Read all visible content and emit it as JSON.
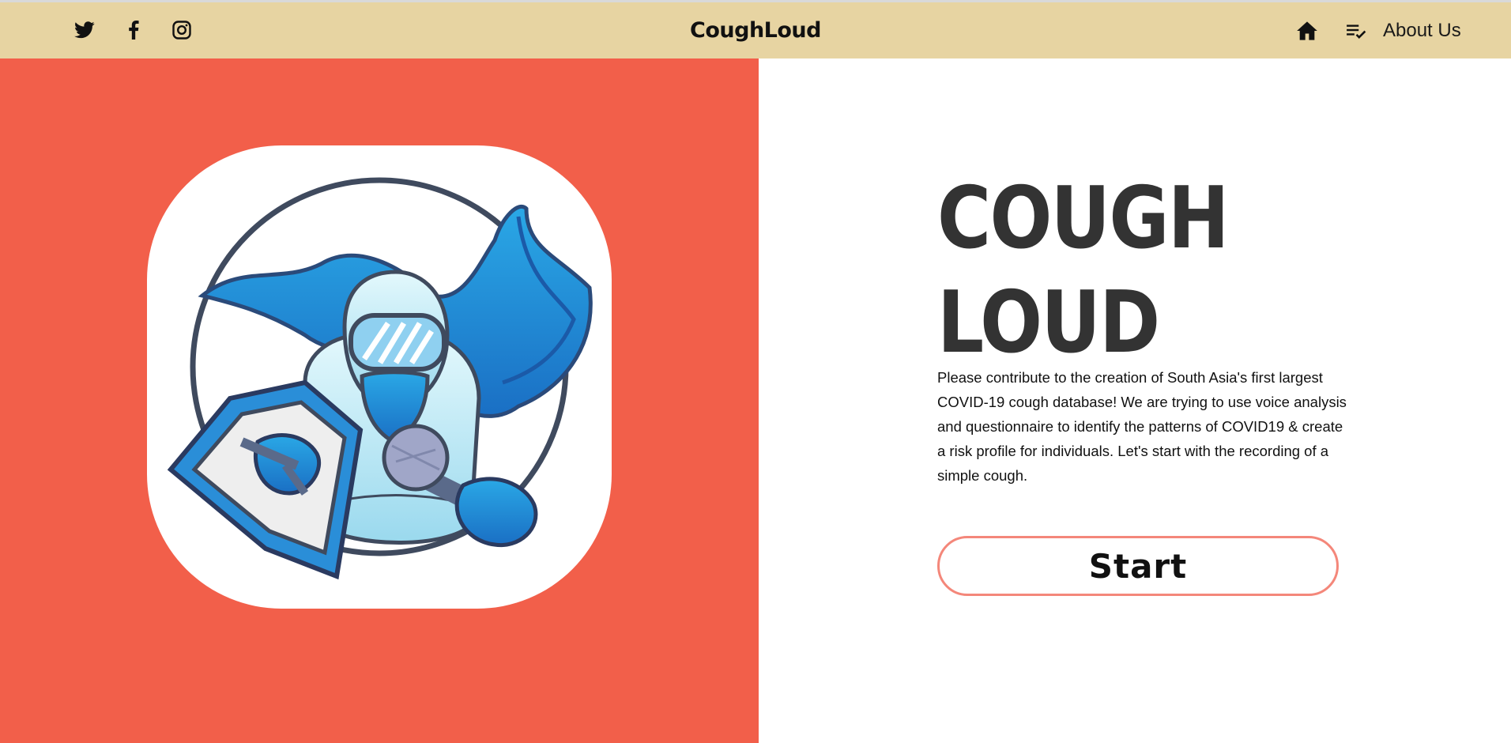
{
  "navbar": {
    "brand": "CoughLoud",
    "background": "#e7d4a2",
    "social_icons": [
      "twitter-icon",
      "facebook-icon",
      "instagram-icon"
    ],
    "right_icons": [
      "home-icon",
      "playlist-check-icon"
    ],
    "about_label": "About Us"
  },
  "hero": {
    "title_line1": "COUGH",
    "title_line2": "LOUD",
    "description": "Please contribute to the creation of South Asia's first largest COVID-19 cough database! We are trying to use voice analysis and questionnaire to identify the patterns of COVID19 & create a risk profile for individuals. Let's start with the recording of a simple cough.",
    "start_label": "Start",
    "accent": "#f25f4a",
    "button_border": "#f4877a"
  },
  "illustration": {
    "name": "superhero-in-hazmat-suit-holding-microphone-and-shield"
  }
}
